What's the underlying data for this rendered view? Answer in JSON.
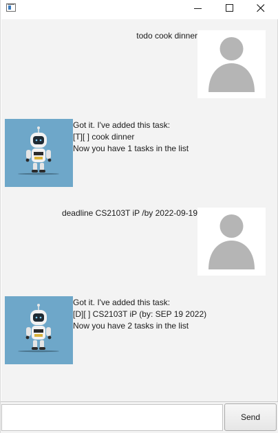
{
  "window": {
    "controls": [
      "minimize-icon",
      "maximize-icon",
      "close-icon"
    ]
  },
  "dialog": {
    "messages": [
      {
        "sender": "user",
        "lines": [
          "todo cook dinner"
        ],
        "avatar": "user-avatar-icon"
      },
      {
        "sender": "bot",
        "lines": [
          "Got it. I've added this task:",
          "[T][ ] cook dinner",
          "Now you have 1 tasks in the list"
        ],
        "avatar": "robot-avatar-icon"
      },
      {
        "sender": "user",
        "lines": [
          "deadline CS2103T iP /by 2022-09-19"
        ],
        "avatar": "user-avatar-icon"
      },
      {
        "sender": "bot",
        "lines": [
          "Got it. I've added this task:",
          "[D][ ] CS2103T iP (by: SEP 19 2022)",
          "Now you have 2 tasks in the list"
        ],
        "avatar": "robot-avatar-icon"
      }
    ]
  },
  "input": {
    "value": "",
    "placeholder": "",
    "send_label": "Send"
  },
  "colors": {
    "dialog_background": "#f3f3f3",
    "bot_avatar_background": "#6ea7c9",
    "user_avatar_silhouette": "#b5b5b5"
  }
}
